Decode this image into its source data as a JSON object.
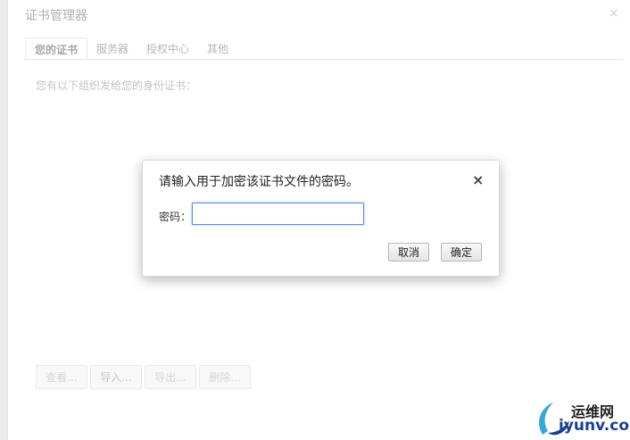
{
  "background_dialog": {
    "title": "证书管理器",
    "close_glyph": "×",
    "tabs": [
      {
        "label": "您的证书",
        "active": true
      },
      {
        "label": "服务器",
        "active": false
      },
      {
        "label": "授权中心",
        "active": false
      },
      {
        "label": "其他",
        "active": false
      }
    ],
    "description": "您有以下组织发给您的身份证书：",
    "buttons": {
      "view": "查看...",
      "import": "导入...",
      "export": "导出...",
      "delete": "删除..."
    }
  },
  "password_dialog": {
    "title": "请输入用于加密该证书文件的密码。",
    "close_glyph": "×",
    "password_label": "密码：",
    "password_value": "",
    "cancel_label": "取消",
    "ok_label": "确定"
  },
  "watermark": {
    "line1": "运维网",
    "line2": "iyunv.com"
  },
  "colors": {
    "accent_input_border": "#5d8fd6",
    "watermark_blue": "#1c3f8f",
    "watermark_swoosh": "#3aa7d8"
  }
}
